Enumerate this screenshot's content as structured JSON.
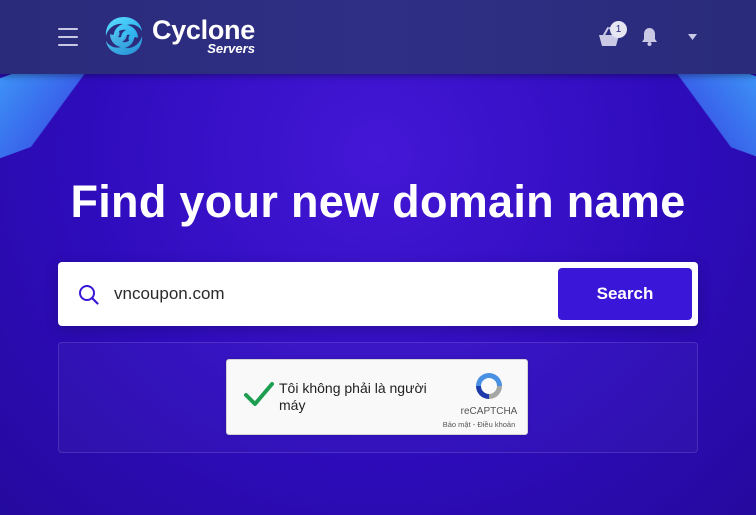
{
  "navbar": {
    "brand_name": "Cyclone",
    "brand_sub": "Servers",
    "cart_count": "1"
  },
  "hero": {
    "headline": "Find your new domain name"
  },
  "search": {
    "value": "vncoupon.com",
    "button_label": "Search"
  },
  "recaptcha": {
    "label": "Tôi không phải là người máy",
    "brand": "reCAPTCHA",
    "privacy": "Bảo mật",
    "separator": " - ",
    "terms": "Điều khoản"
  },
  "colors": {
    "accent": "#3a16d8",
    "navbar": "#2f2f86",
    "check": "#1e9e50"
  }
}
